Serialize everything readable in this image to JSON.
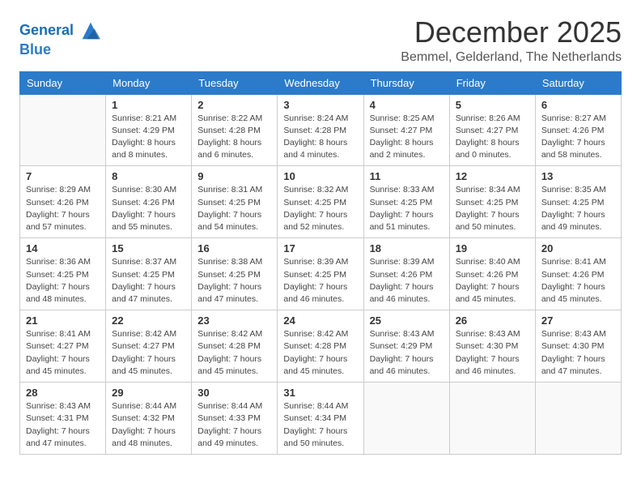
{
  "header": {
    "logo_line1": "General",
    "logo_line2": "Blue",
    "month": "December 2025",
    "location": "Bemmel, Gelderland, The Netherlands"
  },
  "weekdays": [
    "Sunday",
    "Monday",
    "Tuesday",
    "Wednesday",
    "Thursday",
    "Friday",
    "Saturday"
  ],
  "weeks": [
    [
      {
        "day": "",
        "sunrise": "",
        "sunset": "",
        "daylight": ""
      },
      {
        "day": "1",
        "sunrise": "Sunrise: 8:21 AM",
        "sunset": "Sunset: 4:29 PM",
        "daylight": "Daylight: 8 hours and 8 minutes."
      },
      {
        "day": "2",
        "sunrise": "Sunrise: 8:22 AM",
        "sunset": "Sunset: 4:28 PM",
        "daylight": "Daylight: 8 hours and 6 minutes."
      },
      {
        "day": "3",
        "sunrise": "Sunrise: 8:24 AM",
        "sunset": "Sunset: 4:28 PM",
        "daylight": "Daylight: 8 hours and 4 minutes."
      },
      {
        "day": "4",
        "sunrise": "Sunrise: 8:25 AM",
        "sunset": "Sunset: 4:27 PM",
        "daylight": "Daylight: 8 hours and 2 minutes."
      },
      {
        "day": "5",
        "sunrise": "Sunrise: 8:26 AM",
        "sunset": "Sunset: 4:27 PM",
        "daylight": "Daylight: 8 hours and 0 minutes."
      },
      {
        "day": "6",
        "sunrise": "Sunrise: 8:27 AM",
        "sunset": "Sunset: 4:26 PM",
        "daylight": "Daylight: 7 hours and 58 minutes."
      }
    ],
    [
      {
        "day": "7",
        "sunrise": "Sunrise: 8:29 AM",
        "sunset": "Sunset: 4:26 PM",
        "daylight": "Daylight: 7 hours and 57 minutes."
      },
      {
        "day": "8",
        "sunrise": "Sunrise: 8:30 AM",
        "sunset": "Sunset: 4:26 PM",
        "daylight": "Daylight: 7 hours and 55 minutes."
      },
      {
        "day": "9",
        "sunrise": "Sunrise: 8:31 AM",
        "sunset": "Sunset: 4:25 PM",
        "daylight": "Daylight: 7 hours and 54 minutes."
      },
      {
        "day": "10",
        "sunrise": "Sunrise: 8:32 AM",
        "sunset": "Sunset: 4:25 PM",
        "daylight": "Daylight: 7 hours and 52 minutes."
      },
      {
        "day": "11",
        "sunrise": "Sunrise: 8:33 AM",
        "sunset": "Sunset: 4:25 PM",
        "daylight": "Daylight: 7 hours and 51 minutes."
      },
      {
        "day": "12",
        "sunrise": "Sunrise: 8:34 AM",
        "sunset": "Sunset: 4:25 PM",
        "daylight": "Daylight: 7 hours and 50 minutes."
      },
      {
        "day": "13",
        "sunrise": "Sunrise: 8:35 AM",
        "sunset": "Sunset: 4:25 PM",
        "daylight": "Daylight: 7 hours and 49 minutes."
      }
    ],
    [
      {
        "day": "14",
        "sunrise": "Sunrise: 8:36 AM",
        "sunset": "Sunset: 4:25 PM",
        "daylight": "Daylight: 7 hours and 48 minutes."
      },
      {
        "day": "15",
        "sunrise": "Sunrise: 8:37 AM",
        "sunset": "Sunset: 4:25 PM",
        "daylight": "Daylight: 7 hours and 47 minutes."
      },
      {
        "day": "16",
        "sunrise": "Sunrise: 8:38 AM",
        "sunset": "Sunset: 4:25 PM",
        "daylight": "Daylight: 7 hours and 47 minutes."
      },
      {
        "day": "17",
        "sunrise": "Sunrise: 8:39 AM",
        "sunset": "Sunset: 4:25 PM",
        "daylight": "Daylight: 7 hours and 46 minutes."
      },
      {
        "day": "18",
        "sunrise": "Sunrise: 8:39 AM",
        "sunset": "Sunset: 4:26 PM",
        "daylight": "Daylight: 7 hours and 46 minutes."
      },
      {
        "day": "19",
        "sunrise": "Sunrise: 8:40 AM",
        "sunset": "Sunset: 4:26 PM",
        "daylight": "Daylight: 7 hours and 45 minutes."
      },
      {
        "day": "20",
        "sunrise": "Sunrise: 8:41 AM",
        "sunset": "Sunset: 4:26 PM",
        "daylight": "Daylight: 7 hours and 45 minutes."
      }
    ],
    [
      {
        "day": "21",
        "sunrise": "Sunrise: 8:41 AM",
        "sunset": "Sunset: 4:27 PM",
        "daylight": "Daylight: 7 hours and 45 minutes."
      },
      {
        "day": "22",
        "sunrise": "Sunrise: 8:42 AM",
        "sunset": "Sunset: 4:27 PM",
        "daylight": "Daylight: 7 hours and 45 minutes."
      },
      {
        "day": "23",
        "sunrise": "Sunrise: 8:42 AM",
        "sunset": "Sunset: 4:28 PM",
        "daylight": "Daylight: 7 hours and 45 minutes."
      },
      {
        "day": "24",
        "sunrise": "Sunrise: 8:42 AM",
        "sunset": "Sunset: 4:28 PM",
        "daylight": "Daylight: 7 hours and 45 minutes."
      },
      {
        "day": "25",
        "sunrise": "Sunrise: 8:43 AM",
        "sunset": "Sunset: 4:29 PM",
        "daylight": "Daylight: 7 hours and 46 minutes."
      },
      {
        "day": "26",
        "sunrise": "Sunrise: 8:43 AM",
        "sunset": "Sunset: 4:30 PM",
        "daylight": "Daylight: 7 hours and 46 minutes."
      },
      {
        "day": "27",
        "sunrise": "Sunrise: 8:43 AM",
        "sunset": "Sunset: 4:30 PM",
        "daylight": "Daylight: 7 hours and 47 minutes."
      }
    ],
    [
      {
        "day": "28",
        "sunrise": "Sunrise: 8:43 AM",
        "sunset": "Sunset: 4:31 PM",
        "daylight": "Daylight: 7 hours and 47 minutes."
      },
      {
        "day": "29",
        "sunrise": "Sunrise: 8:44 AM",
        "sunset": "Sunset: 4:32 PM",
        "daylight": "Daylight: 7 hours and 48 minutes."
      },
      {
        "day": "30",
        "sunrise": "Sunrise: 8:44 AM",
        "sunset": "Sunset: 4:33 PM",
        "daylight": "Daylight: 7 hours and 49 minutes."
      },
      {
        "day": "31",
        "sunrise": "Sunrise: 8:44 AM",
        "sunset": "Sunset: 4:34 PM",
        "daylight": "Daylight: 7 hours and 50 minutes."
      },
      {
        "day": "",
        "sunrise": "",
        "sunset": "",
        "daylight": ""
      },
      {
        "day": "",
        "sunrise": "",
        "sunset": "",
        "daylight": ""
      },
      {
        "day": "",
        "sunrise": "",
        "sunset": "",
        "daylight": ""
      }
    ]
  ]
}
